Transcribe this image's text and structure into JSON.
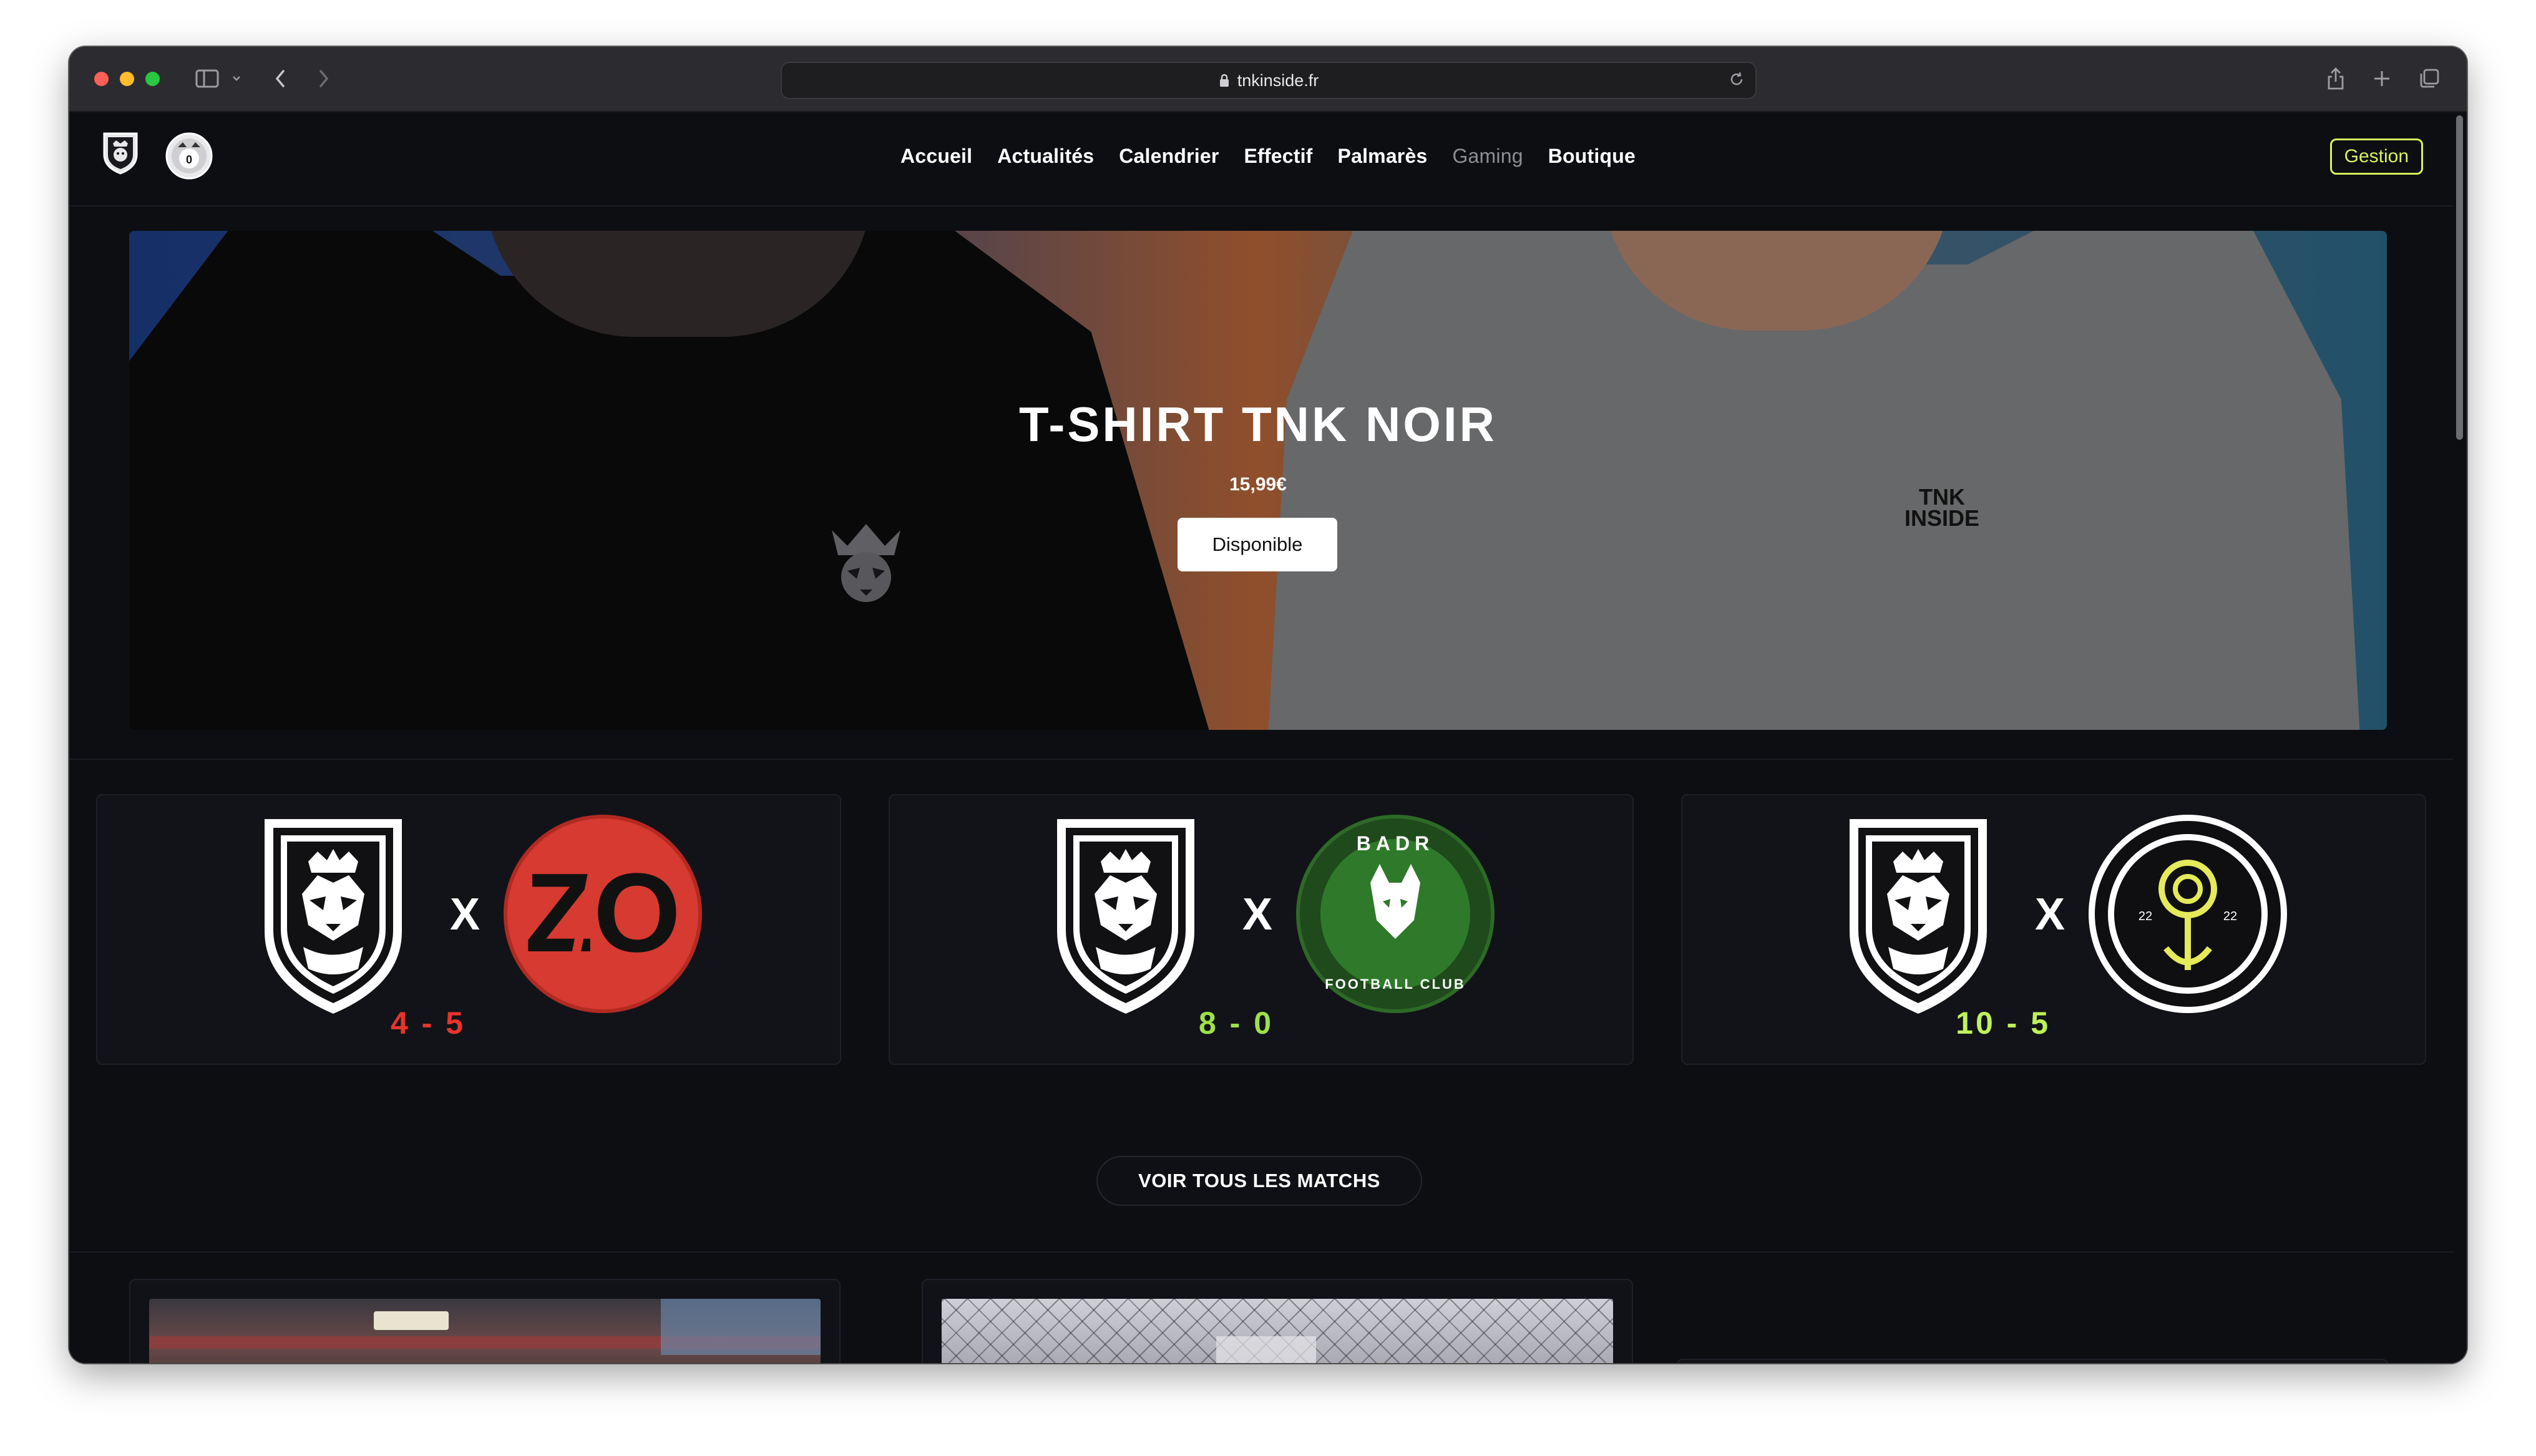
{
  "browser": {
    "url": "tnkinside.fr"
  },
  "nav": {
    "items": [
      {
        "label": "Accueil",
        "active": true
      },
      {
        "label": "Actualités",
        "active": true
      },
      {
        "label": "Calendrier",
        "active": true
      },
      {
        "label": "Effectif",
        "active": true
      },
      {
        "label": "Palmarès",
        "active": true
      },
      {
        "label": "Gaming",
        "active": false
      },
      {
        "label": "Boutique",
        "active": true
      }
    ],
    "gestion_label": "Gestion"
  },
  "hero": {
    "title": "T-SHIRT TNK NOIR",
    "price": "15,99€",
    "button_label": "Disponible",
    "shirt_print": "TNK INSIDE"
  },
  "matches": [
    {
      "score": "4 - 5",
      "score_color": "#e9342b",
      "opponent_logo_text": "ZO",
      "opponent": "zo-red-logo"
    },
    {
      "score": "8 - 0",
      "score_color": "#9ee04a",
      "opponent_logo_text": "BADR",
      "opponent_sub": "FOOTBALL CLUB",
      "opponent": "badr-fc-logo"
    },
    {
      "score": "10 - 5",
      "score_color": "#bff25a",
      "opponent_logo_text": "22",
      "opponent": "anchor-knot-logo"
    }
  ],
  "all_matches_label": "VOIR TOUS LES MATCHS",
  "colors": {
    "accent": "#d7f25b",
    "background": "#0d0e12",
    "card": "#121318"
  }
}
